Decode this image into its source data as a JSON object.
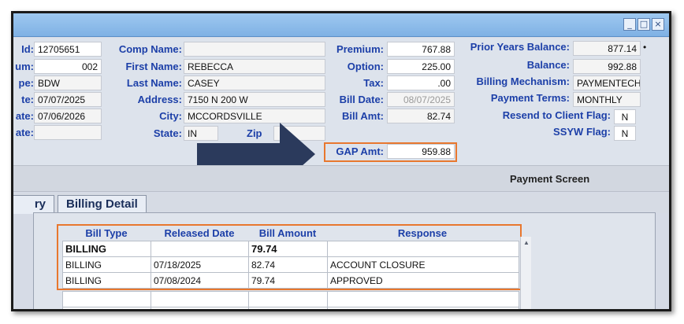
{
  "window": {
    "buttons": {
      "minimize": "_",
      "maximize": "□",
      "close": "×"
    }
  },
  "fields": {
    "col1": [
      {
        "label": "Id:",
        "value": "12705651"
      },
      {
        "label": "um:",
        "value": "002"
      },
      {
        "label": "pe:",
        "value": "BDW"
      },
      {
        "label": "te:",
        "value": "07/07/2025"
      },
      {
        "label": "ate:",
        "value": "07/06/2026"
      },
      {
        "label": "ate:",
        "value": ""
      }
    ],
    "col2": [
      {
        "label": "Comp Name:",
        "value": ""
      },
      {
        "label": "First Name:",
        "value": "REBECCA"
      },
      {
        "label": "Last Name:",
        "value": "CASEY"
      },
      {
        "label": "Address:",
        "value": "7150 N 200 W"
      },
      {
        "label": "City:",
        "value": "MCCORDSVILLE"
      },
      {
        "label": "State:",
        "value": "IN"
      },
      {
        "label": "Zip",
        "value": ""
      }
    ],
    "col3": [
      {
        "label": "Premium:",
        "value": "767.88"
      },
      {
        "label": "Option:",
        "value": "225.00"
      },
      {
        "label": "Tax:",
        "value": ".00"
      },
      {
        "label": "Bill Date:",
        "value": "08/07/2025"
      },
      {
        "label": "Bill Amt:",
        "value": "82.74"
      },
      {
        "label": "GAP Amt:",
        "value": "959.88"
      }
    ],
    "col4": [
      {
        "label": "Prior Years Balance:",
        "value": "877.14"
      },
      {
        "label": "Balance:",
        "value": "992.88"
      },
      {
        "label": "Billing Mechanism:",
        "value": "PAYMENTECH"
      },
      {
        "label": "Payment Terms:",
        "value": "MONTHLY"
      },
      {
        "label": "Resend to Client Flag:",
        "value": "N"
      },
      {
        "label": "SSYW Flag:",
        "value": "N"
      }
    ],
    "bullet": "•"
  },
  "payment_screen": "Payment Screen",
  "tabs": [
    {
      "label": "ry"
    },
    {
      "label": "Billing Detail"
    }
  ],
  "table": {
    "columns": [
      "Bill Type",
      "Released Date",
      "Bill Amount",
      "Response"
    ],
    "rows": [
      [
        "BILLING",
        "",
        "79.74",
        ""
      ],
      [
        "BILLING",
        "07/18/2025",
        "82.74",
        "ACCOUNT CLOSURE"
      ],
      [
        "BILLING",
        "07/08/2024",
        "79.74",
        "APPROVED"
      ],
      [
        "",
        "",
        "",
        ""
      ],
      [
        "",
        "",
        "",
        ""
      ]
    ]
  },
  "colors": {
    "label_blue": "#1c3fa8",
    "highlight_orange": "#e8772e",
    "arrow_navy": "#2b3a5c"
  },
  "icons": {
    "arrow": "right-arrow-annotation",
    "scroll": "scroll-up-icon"
  }
}
